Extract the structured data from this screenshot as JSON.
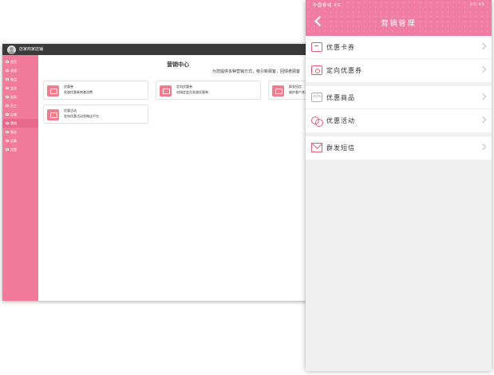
{
  "desktop": {
    "store_name": "店家商家店铺",
    "sidebar": [
      {
        "label": "首页"
      },
      {
        "label": "收银"
      },
      {
        "label": "商品"
      },
      {
        "label": "会员"
      },
      {
        "label": "报表"
      },
      {
        "label": "员工"
      },
      {
        "label": "店铺"
      },
      {
        "label": "营销"
      },
      {
        "label": "微店"
      },
      {
        "label": "设备"
      },
      {
        "label": "设置"
      }
    ],
    "active_index": 7,
    "title": "营销中心",
    "subtitle": "为您提供多种营销方式，吸引新顾客，回馈老顾客",
    "cards": [
      {
        "title": "优惠券",
        "desc": "发放优惠券刺激消费"
      },
      {
        "title": "定向优惠券",
        "desc": "向指定会员发放优惠券"
      },
      {
        "title": "群发短信",
        "desc": "维护客户关系"
      },
      {
        "title": "优惠活动",
        "desc": "发布优惠活动到微店平台"
      }
    ]
  },
  "mobile": {
    "status_left": "中国移动 4G",
    "status_right": "20:45",
    "title": "营销管理",
    "groups": [
      [
        {
          "label": "优惠卡券",
          "icon": "card-icon"
        },
        {
          "label": "定向优惠券",
          "icon": "ticket-icon"
        }
      ],
      [
        {
          "label": "优惠商品",
          "icon": "goods-icon"
        },
        {
          "label": "优惠活动",
          "icon": "activity-icon"
        }
      ],
      [
        {
          "label": "群发短信",
          "icon": "mail-icon"
        }
      ]
    ]
  },
  "colors": {
    "accent": "#f07ca4",
    "sidebar": "#f27a9b",
    "topbar": "#3a3a3a"
  }
}
